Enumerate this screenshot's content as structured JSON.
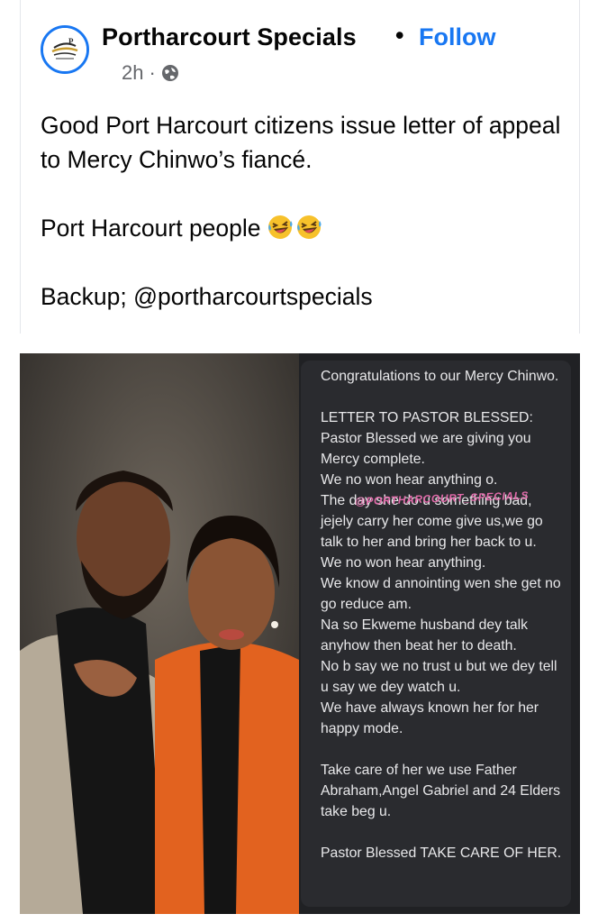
{
  "post": {
    "page_name": "Portharcourt Specials",
    "separator": "•",
    "follow_label": "Follow",
    "time": "2h",
    "meta_dot": "·",
    "privacy_icon": "globe-icon",
    "line1": "Good Port Harcourt citizens issue letter of appeal to Mercy Chinwo’s fiancé.",
    "line2": "Port Harcourt people",
    "emoji": "laughing-tears-emoji",
    "line3": "Backup; @portharcourtspecials",
    "accent_color": "#1877f2"
  },
  "image": {
    "watermark": "@PORTHARCOURT_SPECIALS",
    "letter": "Congratulations to our Mercy Chinwo.\n\nLETTER TO PASTOR BLESSED:\nPastor Blessed we are giving you Mercy complete.\nWe no won hear anything o.\nThe day she do u something bad, jejely carry her come give us,we go talk to her and bring her back to u.\nWe no won hear anything.\nWe know d annointing wen she get no go reduce am.\nNa so Ekweme husband dey talk anyhow then beat her to death.\nNo b say we no trust u but we dey tell u say we dey watch u.\nWe have always known her for her happy mode.\n\nTake care of her we use Father Abraham,Angel Gabriel and 24 Elders take beg u.\n\nPastor Blessed TAKE CARE OF HER."
  }
}
